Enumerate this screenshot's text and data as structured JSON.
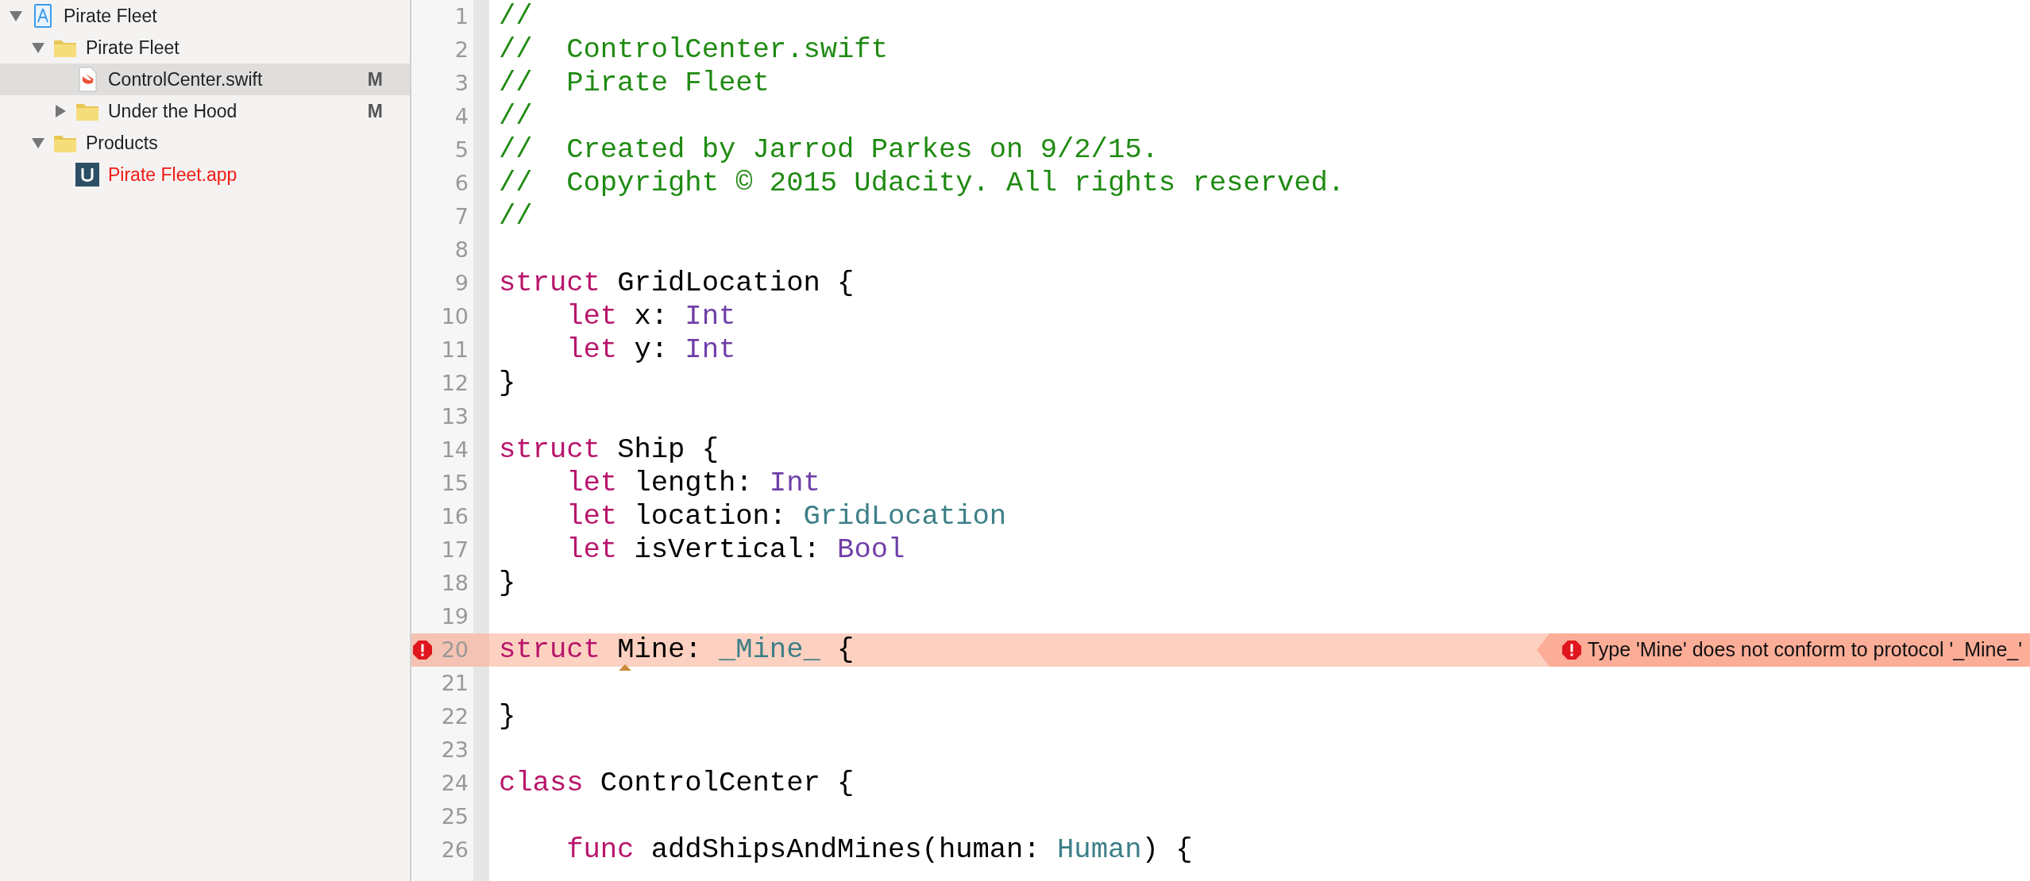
{
  "navigator": {
    "items": [
      {
        "kind": "project",
        "name": "Pirate Fleet",
        "expanded": true,
        "selected": false,
        "children": [
          {
            "kind": "folder",
            "name": "Pirate Fleet",
            "expanded": true,
            "selected": false,
            "children": [
              {
                "kind": "swift",
                "name": "ControlCenter.swift",
                "selected": true,
                "badge": "M"
              },
              {
                "kind": "folder",
                "name": "Under the Hood",
                "expanded": false,
                "selected": false,
                "badge": "M"
              }
            ]
          },
          {
            "kind": "folder",
            "name": "Products",
            "expanded": true,
            "selected": false,
            "children": [
              {
                "kind": "app",
                "name": "Pirate Fleet.app",
                "selected": false,
                "missing": true
              }
            ]
          }
        ]
      }
    ]
  },
  "editor": {
    "lines": [
      {
        "number": "1",
        "tokens": [
          {
            "kind": "comment",
            "text": "//"
          }
        ]
      },
      {
        "number": "2",
        "tokens": [
          {
            "kind": "comment",
            "text": "//  ControlCenter.swift"
          }
        ]
      },
      {
        "number": "3",
        "tokens": [
          {
            "kind": "comment",
            "text": "//  Pirate Fleet"
          }
        ]
      },
      {
        "number": "4",
        "tokens": [
          {
            "kind": "comment",
            "text": "//"
          }
        ]
      },
      {
        "number": "5",
        "tokens": [
          {
            "kind": "comment",
            "text": "//  Created by Jarrod Parkes on 9/2/15."
          }
        ]
      },
      {
        "number": "6",
        "tokens": [
          {
            "kind": "comment",
            "text": "//  Copyright © 2015 Udacity. All rights reserved."
          }
        ]
      },
      {
        "number": "7",
        "tokens": [
          {
            "kind": "comment",
            "text": "//"
          }
        ]
      },
      {
        "number": "8"
      },
      {
        "number": "9",
        "tokens": [
          {
            "kind": "keyword",
            "text": "struct"
          },
          {
            "kind": "plain",
            "text": " GridLocation {"
          }
        ]
      },
      {
        "number": "10",
        "tokens": [
          {
            "kind": "keyword",
            "text": "    let"
          },
          {
            "kind": "plain",
            "text": " x: "
          },
          {
            "kind": "type",
            "text": "Int"
          }
        ]
      },
      {
        "number": "11",
        "tokens": [
          {
            "kind": "keyword",
            "text": "    let"
          },
          {
            "kind": "plain",
            "text": " y: "
          },
          {
            "kind": "type",
            "text": "Int"
          }
        ]
      },
      {
        "number": "12",
        "tokens": [
          {
            "kind": "plain",
            "text": "}"
          }
        ]
      },
      {
        "number": "13"
      },
      {
        "number": "14",
        "tokens": [
          {
            "kind": "keyword",
            "text": "struct"
          },
          {
            "kind": "plain",
            "text": " Ship {"
          }
        ]
      },
      {
        "number": "15",
        "tokens": [
          {
            "kind": "keyword",
            "text": "    let"
          },
          {
            "kind": "plain",
            "text": " length: "
          },
          {
            "kind": "type",
            "text": "Int"
          }
        ]
      },
      {
        "number": "16",
        "tokens": [
          {
            "kind": "keyword",
            "text": "    let"
          },
          {
            "kind": "plain",
            "text": " location: "
          },
          {
            "kind": "project_type",
            "text": "GridLocation"
          }
        ]
      },
      {
        "number": "17",
        "tokens": [
          {
            "kind": "keyword",
            "text": "    let"
          },
          {
            "kind": "plain",
            "text": " isVertical: "
          },
          {
            "kind": "type",
            "text": "Bool"
          }
        ]
      },
      {
        "number": "18",
        "tokens": [
          {
            "kind": "plain",
            "text": "}"
          }
        ]
      },
      {
        "number": "19"
      },
      {
        "number": "20",
        "error": "Type 'Mine' does not conform to protocol '_Mine_'",
        "tokens": [
          {
            "kind": "keyword",
            "text": "struct"
          },
          {
            "kind": "plain",
            "text": " Mine:",
            "issue": true
          },
          {
            "kind": "project_type",
            "text": " _Mine_"
          },
          {
            "kind": "plain",
            "text": " {"
          }
        ]
      },
      {
        "number": "21"
      },
      {
        "number": "22",
        "tokens": [
          {
            "kind": "plain",
            "text": "}"
          }
        ]
      },
      {
        "number": "23"
      },
      {
        "number": "24",
        "tokens": [
          {
            "kind": "keyword",
            "text": "class"
          },
          {
            "kind": "plain",
            "text": " ControlCenter {"
          }
        ]
      },
      {
        "number": "25"
      },
      {
        "number": "26",
        "tokens": [
          {
            "kind": "keyword",
            "text": "    func"
          },
          {
            "kind": "plain",
            "text": " addShipsAndMines(human: "
          },
          {
            "kind": "project_type",
            "text": "Human"
          },
          {
            "kind": "plain",
            "text": ") {"
          }
        ]
      }
    ]
  }
}
